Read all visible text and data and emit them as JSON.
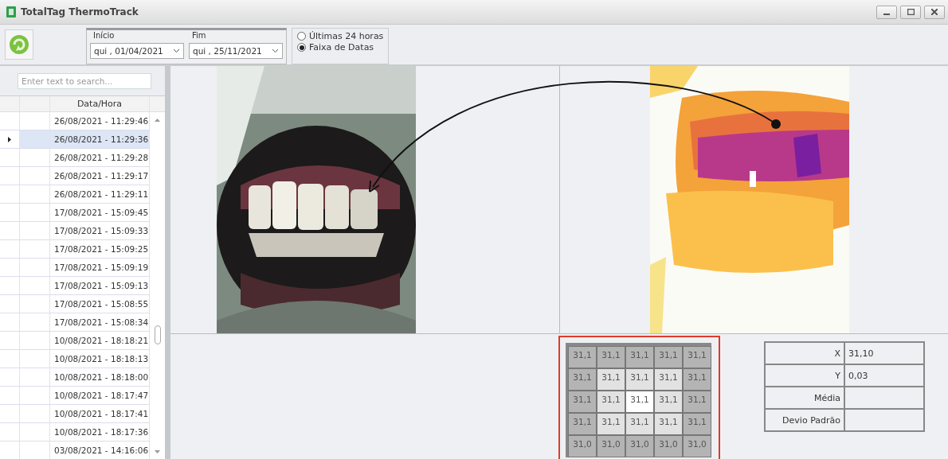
{
  "window": {
    "title": "TotalTag ThermoTrack"
  },
  "filter": {
    "start_label": "Início",
    "start_value": "qui , 01/04/2021",
    "end_label": "Fim",
    "end_value": "qui , 25/11/2021",
    "options": [
      {
        "label": "Últimas 24 horas",
        "selected": false
      },
      {
        "label": "Faixa de Datas",
        "selected": true
      }
    ]
  },
  "search": {
    "placeholder": "Enter text to search..."
  },
  "table": {
    "columns": [
      "Data/Hora"
    ],
    "rows": [
      {
        "date_time": "26/08/2021 - 11:29:46",
        "selected": false
      },
      {
        "date_time": "26/08/2021 - 11:29:36",
        "selected": true
      },
      {
        "date_time": "26/08/2021 - 11:29:28",
        "selected": false
      },
      {
        "date_time": "26/08/2021 - 11:29:17",
        "selected": false
      },
      {
        "date_time": "26/08/2021 - 11:29:11",
        "selected": false
      },
      {
        "date_time": "17/08/2021 - 15:09:45",
        "selected": false
      },
      {
        "date_time": "17/08/2021 - 15:09:33",
        "selected": false
      },
      {
        "date_time": "17/08/2021 - 15:09:25",
        "selected": false
      },
      {
        "date_time": "17/08/2021 - 15:09:19",
        "selected": false
      },
      {
        "date_time": "17/08/2021 - 15:09:13",
        "selected": false
      },
      {
        "date_time": "17/08/2021 - 15:08:55",
        "selected": false
      },
      {
        "date_time": "17/08/2021 - 15:08:34",
        "selected": false
      },
      {
        "date_time": "10/08/2021 - 18:18:21",
        "selected": false
      },
      {
        "date_time": "10/08/2021 - 18:18:13",
        "selected": false
      },
      {
        "date_time": "10/08/2021 - 18:18:00",
        "selected": false
      },
      {
        "date_time": "10/08/2021 - 18:17:47",
        "selected": false
      },
      {
        "date_time": "10/08/2021 - 18:17:41",
        "selected": false
      },
      {
        "date_time": "10/08/2021 - 18:17:36",
        "selected": false
      },
      {
        "date_time": "03/08/2021 - 14:16:06",
        "selected": false
      }
    ]
  },
  "grid": {
    "rows": [
      [
        {
          "value": "31,1",
          "kind": "edge"
        },
        {
          "value": "31,1",
          "kind": "edge"
        },
        {
          "value": "31,1",
          "kind": "edge"
        },
        {
          "value": "31,1",
          "kind": "edge"
        },
        {
          "value": "31,1",
          "kind": "edge"
        }
      ],
      [
        {
          "value": "31,1",
          "kind": "edge"
        },
        {
          "value": "31,1",
          "kind": "inner"
        },
        {
          "value": "31,1",
          "kind": "inner"
        },
        {
          "value": "31,1",
          "kind": "inner"
        },
        {
          "value": "31,1",
          "kind": "edge"
        }
      ],
      [
        {
          "value": "31,1",
          "kind": "edge"
        },
        {
          "value": "31,1",
          "kind": "inner"
        },
        {
          "value": "31,1",
          "kind": "center"
        },
        {
          "value": "31,1",
          "kind": "inner"
        },
        {
          "value": "31,1",
          "kind": "edge"
        }
      ],
      [
        {
          "value": "31,1",
          "kind": "edge"
        },
        {
          "value": "31,1",
          "kind": "inner"
        },
        {
          "value": "31,1",
          "kind": "inner"
        },
        {
          "value": "31,1",
          "kind": "inner"
        },
        {
          "value": "31,1",
          "kind": "edge"
        }
      ],
      [
        {
          "value": "31,0",
          "kind": "edge"
        },
        {
          "value": "31,0",
          "kind": "edge"
        },
        {
          "value": "31,0",
          "kind": "edge"
        },
        {
          "value": "31,0",
          "kind": "edge"
        },
        {
          "value": "31,0",
          "kind": "edge"
        }
      ]
    ]
  },
  "stats": [
    {
      "label": "X",
      "value": "31,10"
    },
    {
      "label": "Y",
      "value": "0,03"
    },
    {
      "label": "Média"
    },
    {
      "label": "Devio Padrão"
    }
  ]
}
